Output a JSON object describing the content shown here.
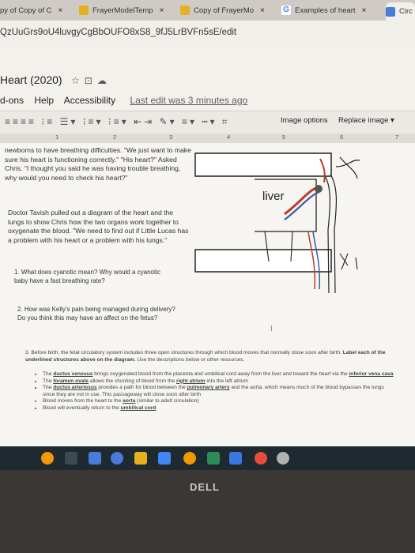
{
  "browser": {
    "tabs": [
      {
        "title": "py of Copy of C",
        "close": "×",
        "color": "#c0392b"
      },
      {
        "title": "FrayerModelTemp",
        "close": "×",
        "color": "#e6b022"
      },
      {
        "title": "Copy of FrayerMo",
        "close": "×",
        "color": "#e6b022"
      },
      {
        "title": "Examples of heart",
        "close": "×",
        "color": "#4285f4",
        "icon_letter": "G"
      },
      {
        "title": "Circ",
        "close": "",
        "color": "#4a7bd9"
      }
    ],
    "url": "QzUuGrs9oU4luvgyCgBbOUFO8xS8_9fJ5LrBVFn5sE/edit"
  },
  "doc": {
    "title": "Heart (2020)",
    "menus": [
      "d-ons",
      "Help",
      "Accessibility"
    ],
    "last_edit": "Last edit was 3 minutes ago"
  },
  "toolbar": {
    "image_options": "Image options",
    "replace_image": "Replace image ▾"
  },
  "ruler": {
    "marks": [
      "1",
      "2",
      "3",
      "4",
      "5",
      "6",
      "7"
    ]
  },
  "content": {
    "para1": "newborns to have breathing difficulties. \"We just want to make sure his heart is functioning correctly.\" \"His heart?\" Asked Chris. \"I thought you said he was having trouble breathing, why would you need to check his heart?\"",
    "para2": "Doctor Tavish pulled out a diagram of the heart and the lungs to show Chris how the two organs work together to oxygenate the blood. \"We need to find out if Little Lucas has a problem with his heart or a problem with his lungs.\"",
    "q1": "1. What does cyanotic mean? Why would a cyanotic baby have a fast breathing rate?",
    "q2": "2. How was Kelly's pain being managed during delivery? Do you think this may have an affect on the fetus?",
    "q3a": "3. Before birth, the fetal circulatory system includes three open structures through which blood moves that normally close soon after birth.",
    "q3b": "Label each of the underlined structures above on the diagram.",
    "q3c": "Use the descriptions below or other resources.",
    "b1a": "The",
    "b1u": "ductus venosus",
    "b1b": "brings oxygenated blood from the placenta and umbilical cord away from the liver and toward the heart via the",
    "b1u2": "inferior vena cava",
    "b2a": "The",
    "b2u": "foramen ovale",
    "b2b": "allows the shunting of blood from the",
    "b2u2": "right atrium",
    "b2c": "into the left atrium",
    "b3a": "The",
    "b3u": "ductus arteriosus",
    "b3b": "provides a path for blood between the",
    "b3u2": "pulmonary artery",
    "b3c": "and the aorta, which means much of the blood bypasses the lungs since they are not in use. This passageway will close soon after birth",
    "b4a": "Blood moves from the heart to the",
    "b4u": "aorta",
    "b4b": "(similar to adult circulation)",
    "b5a": "Blood will eventually return to the",
    "b5u": "umbilical cord",
    "diagram_label": "liver"
  },
  "laptop": {
    "brand": "DELL"
  }
}
